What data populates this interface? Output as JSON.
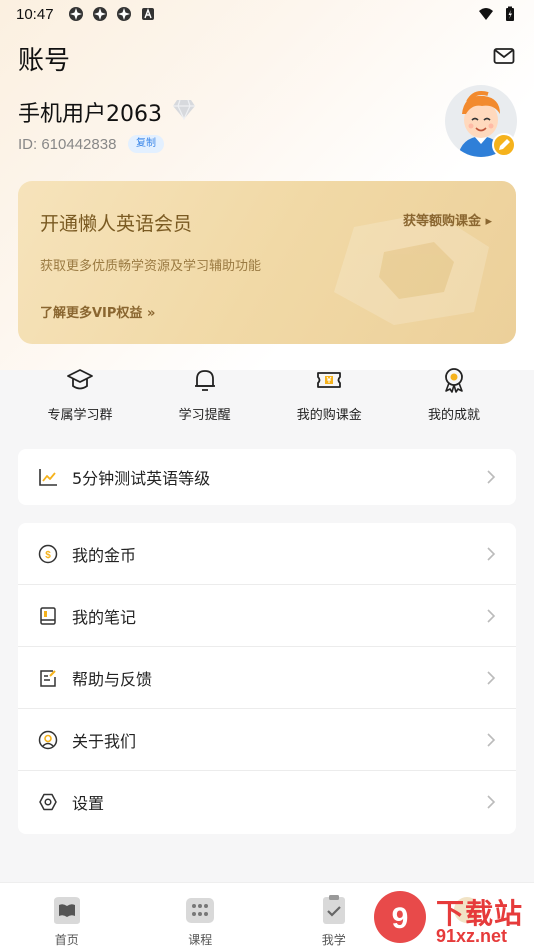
{
  "status_bar": {
    "time": "10:47"
  },
  "header": {
    "title": "账号"
  },
  "profile": {
    "username": "手机用户2063",
    "id_text": "ID: 610442838",
    "copy_label": "复制"
  },
  "vip": {
    "title": "开通懒人英语会员",
    "subtitle": "获取更多优质畅学资源及学习辅助功能",
    "more_link": "了解更多VIP权益 »",
    "right_link": "获等额购课金 ▸"
  },
  "quick_actions": [
    {
      "label": "专属学习群",
      "icon": "graduation-cap-icon"
    },
    {
      "label": "学习提醒",
      "icon": "bell-icon"
    },
    {
      "label": "我的购课金",
      "icon": "ticket-icon"
    },
    {
      "label": "我的成就",
      "icon": "medal-icon"
    }
  ],
  "test_entry": {
    "label": "5分钟测试英语等级"
  },
  "menu": [
    {
      "label": "我的金币",
      "icon": "coin-icon"
    },
    {
      "label": "我的笔记",
      "icon": "notebook-icon"
    },
    {
      "label": "帮助与反馈",
      "icon": "feedback-icon"
    },
    {
      "label": "关于我们",
      "icon": "about-icon"
    },
    {
      "label": "设置",
      "icon": "settings-icon"
    }
  ],
  "tabbar": [
    {
      "label": "首页"
    },
    {
      "label": "课程"
    },
    {
      "label": "我学"
    },
    {
      "label": ""
    }
  ],
  "watermark": {
    "line1": "下载站",
    "line2": "91xz.net"
  },
  "colors": {
    "vip_gold": "#f1d9a6",
    "accent_blue": "#3a86e8",
    "watermark_red": "#e63b3b"
  }
}
